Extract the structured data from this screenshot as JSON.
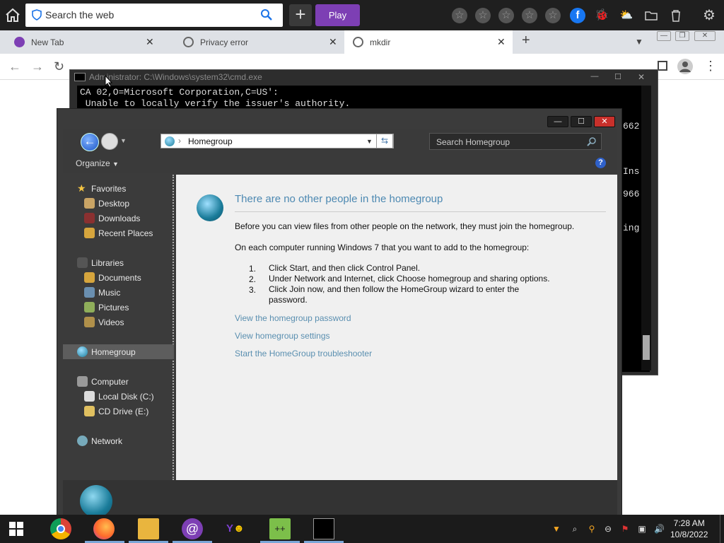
{
  "topbar": {
    "search_placeholder": "Search the web",
    "play_label": "Play",
    "plus_label": "+"
  },
  "tabs": [
    {
      "title": "New Tab",
      "close": "✕"
    },
    {
      "title": "Privacy error",
      "close": "✕"
    },
    {
      "title": "mkdir",
      "close": "✕"
    }
  ],
  "tab_add": "+",
  "cmd": {
    "title": "Administrator: C:\\Windows\\system32\\cmd.exe",
    "lines": [
      "CA 02,O=Microsoft Corporation,C=US':",
      " Unable to locally verify the issuer's authority."
    ],
    "right_fragments": [
      "662",
      "Ins",
      "966",
      "ing"
    ]
  },
  "explorer": {
    "address": "Homegroup",
    "search_placeholder": "Search Homegroup",
    "organize": "Organize",
    "help": "?",
    "nav": {
      "favorites": "Favorites",
      "desktop": "Desktop",
      "downloads": "Downloads",
      "recent_places": "Recent Places",
      "libraries": "Libraries",
      "documents": "Documents",
      "music": "Music",
      "pictures": "Pictures",
      "videos": "Videos",
      "homegroup": "Homegroup",
      "computer": "Computer",
      "local_disk": "Local Disk (C:)",
      "cd_drive": "CD Drive (E:)",
      "network": "Network"
    },
    "content": {
      "heading": "There are no other people in the homegroup",
      "p1": "Before you can view files from other people on the network, they must join the homegroup.",
      "p2": "On each computer running Windows 7 that you want to add to the homegroup:",
      "steps": [
        {
          "num": "1.",
          "text": "Click Start, and then click Control Panel."
        },
        {
          "num": "2.",
          "text": "Under Network and Internet, click Choose homegroup and sharing options."
        },
        {
          "num": "3.",
          "text": "Click Join now, and then follow the HomeGroup wizard to enter the password."
        }
      ],
      "links": [
        "View the homegroup password",
        "View homegroup settings",
        "Start the HomeGroup troubleshooter"
      ]
    }
  },
  "taskbar": {
    "time": "7:28 AM",
    "date": "10/8/2022"
  }
}
